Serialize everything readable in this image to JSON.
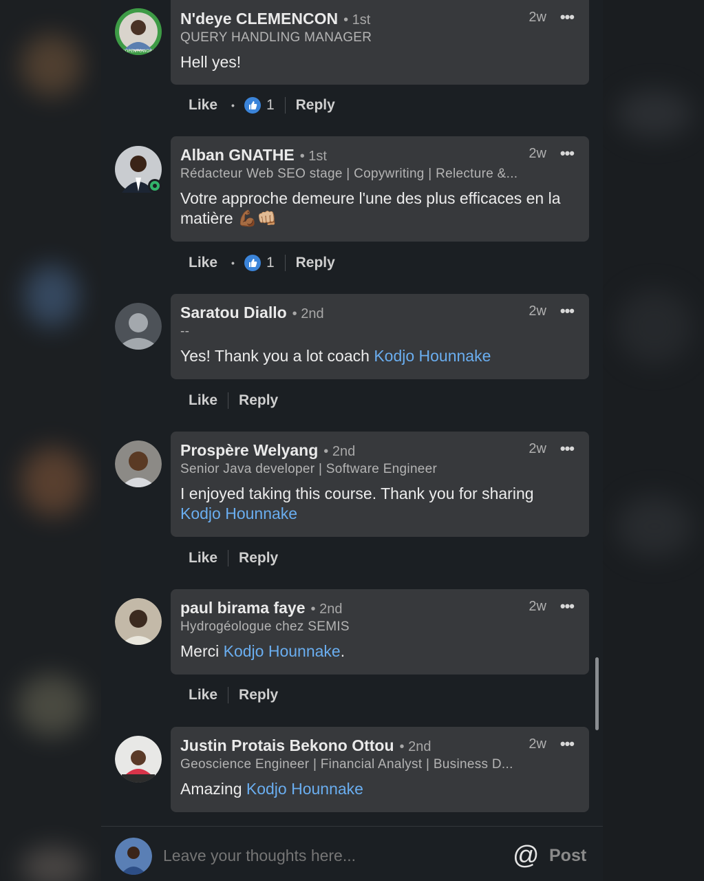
{
  "comments": [
    {
      "name": "N'deye CLEMENCON",
      "degree": "• 1st",
      "headline": "QUERY HANDLING MANAGER",
      "time": "2w",
      "text": "Hell yes!",
      "like": "Like",
      "reply": "Reply",
      "reaction_count": "1",
      "avatar_badge": "#OPENTOWORK"
    },
    {
      "name": "Alban GNATHE",
      "degree": "• 1st",
      "headline": "Rédacteur Web SEO stage | Copywriting | Relecture &...",
      "time": "2w",
      "text": "Votre approche demeure l'une des plus efficaces en la matière 💪🏾👊🏼",
      "like": "Like",
      "reply": "Reply",
      "reaction_count": "1"
    },
    {
      "name": "Saratou Diallo",
      "degree": "• 2nd",
      "headline": "--",
      "time": "2w",
      "text_before": "Yes! Thank you a lot coach ",
      "mention": "Kodjo Hounnake",
      "like": "Like",
      "reply": "Reply"
    },
    {
      "name": "Prospère Welyang",
      "degree": "• 2nd",
      "headline": "Senior Java developer | Software Engineer",
      "time": "2w",
      "text_before": "I enjoyed taking this course. Thank you for sharing",
      "mention": "Kodjo Hounnake",
      "like": "Like",
      "reply": "Reply"
    },
    {
      "name": "paul birama faye",
      "degree": "• 2nd",
      "headline": "Hydrogéologue chez SEMIS",
      "time": "2w",
      "text_before": "Merci ",
      "mention": "Kodjo Hounnake",
      "text_after": ".",
      "like": "Like",
      "reply": "Reply"
    },
    {
      "name": "Justin Protais Bekono Ottou",
      "degree": "• 2nd",
      "headline": "Geoscience Engineer | Financial Analyst | Business D...",
      "time": "2w",
      "text_before": "Amazing ",
      "mention": "Kodjo Hounnake"
    }
  ],
  "composer": {
    "placeholder": "Leave your thoughts here...",
    "at_symbol": "@",
    "post_label": "Post"
  },
  "colors": {
    "mention": "#6aaef0",
    "bubble": "#37393c",
    "background": "#1b1f23",
    "reaction": "#3b84d9"
  }
}
